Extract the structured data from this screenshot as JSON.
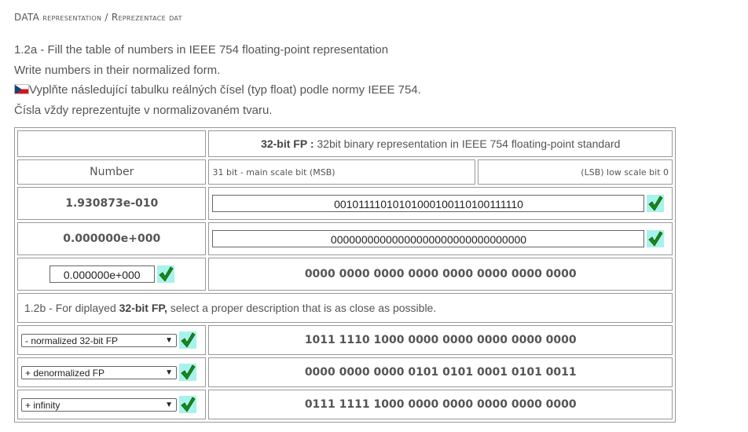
{
  "breadcrumb": "DATA representation / Reprezentace dat",
  "intro": {
    "line1": "1.2a - Fill the table of numbers in IEEE 754 floating-point representation",
    "line2": "Write numbers in their normalized form.",
    "line3": "Vyplňte následující tabulku reálných čísel (typ float) podle normy IEEE 754.",
    "line4": "Čísla vždy reprezentujte v normalizovaném tvaru."
  },
  "table": {
    "fp_header_bold": "32-bit FP :",
    "fp_header_text": " 32bit binary representation in IEEE 754 floating-point standard",
    "number_header": "Number",
    "msb_label": "31 bit - main scale bit (MSB)",
    "lsb_label": "(LSB) low scale bit 0",
    "rows": [
      {
        "number": "1.930873e-010",
        "bits": "00101111010101000100110100111110"
      },
      {
        "number": "0.000000e+000",
        "bits": "00000000000000000000000000000000"
      },
      {
        "number": "0.000000e+000",
        "bits": "0000 0000 0000 0000 0000 0000 0000 0000"
      }
    ]
  },
  "part_b": {
    "prefix": "1.2b - For diplayed ",
    "bold": "32-bit FP,",
    "suffix": " select a proper description that is as close as possible.",
    "rows": [
      {
        "selected": "- normalized 32-bit FP",
        "bits": "1011 1110 1000 0000 0000 0000 0000 0000"
      },
      {
        "selected": "+ denormalized FP",
        "bits": "0000 0000 0000 0101 0101 0001 0101 0011"
      },
      {
        "selected": "+ infinity",
        "bits": "0111 1111 1000 0000 0000 0000 0000 0000"
      }
    ]
  },
  "colors": {
    "check_bg": "#a8f2ec",
    "check_mark": "#1a8a1a"
  },
  "icons": {
    "check": "check-icon",
    "flag": "czech-flag-icon",
    "dropdown": "chevron-down-icon"
  }
}
